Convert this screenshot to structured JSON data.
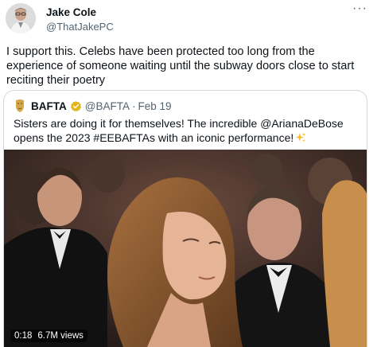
{
  "author": {
    "name": "Jake Cole",
    "handle": "@ThatJakePC",
    "avatar_icon": "avatar-photo"
  },
  "menu_icon": "more-horizontal-icon",
  "tweet": {
    "text": "I support this. Celebs have been protected too long from the experience of someone waiting until the subway doors close to start reciting their poetry"
  },
  "quoted": {
    "name": "BAFTA",
    "handle": "@BAFTA",
    "separator": "·",
    "date": "Feb 19",
    "text": "Sisters are doing it for themselves! The incredible @ArianaDeBose opens the 2023 #EEBAFTAs with an iconic performance!",
    "verified_color": "#e2b719",
    "video": {
      "duration": "0:18",
      "views": "6.7M views"
    }
  }
}
